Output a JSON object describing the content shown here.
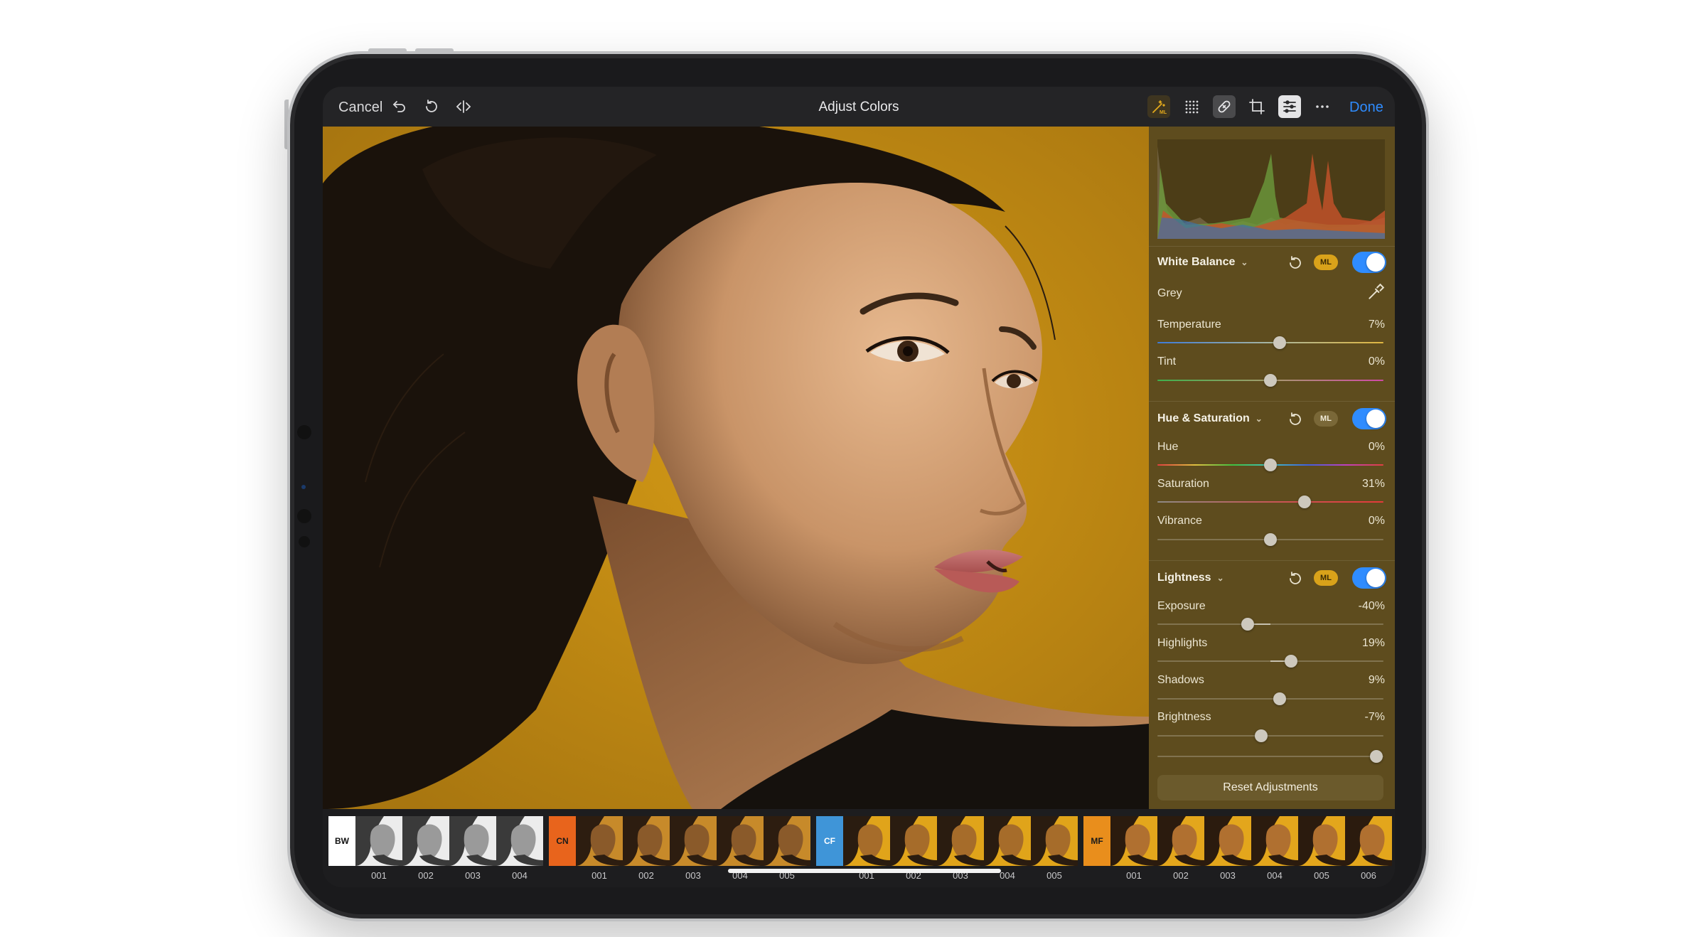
{
  "toolbar": {
    "cancel_label": "Cancel",
    "title": "Adjust Colors",
    "done_label": "Done",
    "icons": [
      "undo-icon",
      "revert-icon",
      "compare-icon",
      "ml-enhance-icon",
      "grid-icon",
      "repair-brush-icon",
      "crop-icon",
      "adjustments-icon",
      "more-icon"
    ]
  },
  "panel": {
    "white_balance": {
      "title": "White Balance",
      "ml": "ML",
      "enabled": true,
      "grey_label": "Grey",
      "temperature": {
        "label": "Temperature",
        "value": "7%",
        "position": 0.54
      },
      "tint": {
        "label": "Tint",
        "value": "0%",
        "position": 0.5
      }
    },
    "hue_saturation": {
      "title": "Hue & Saturation",
      "ml": "ML",
      "enabled": true,
      "hue": {
        "label": "Hue",
        "value": "0%",
        "position": 0.5
      },
      "saturation": {
        "label": "Saturation",
        "value": "31%",
        "position": 0.65
      },
      "vibrance": {
        "label": "Vibrance",
        "value": "0%",
        "position": 0.5
      }
    },
    "lightness": {
      "title": "Lightness",
      "ml": "ML",
      "enabled": true,
      "exposure": {
        "label": "Exposure",
        "value": "-40%",
        "position": 0.4
      },
      "highlights": {
        "label": "Highlights",
        "value": "19%",
        "position": 0.59
      },
      "shadows": {
        "label": "Shadows",
        "value": "9%",
        "position": 0.54
      },
      "brightness": {
        "label": "Brightness",
        "value": "-7%",
        "position": 0.46
      }
    },
    "reset_label": "Reset Adjustments"
  },
  "filmstrip": {
    "groups": [
      {
        "tag": "BW",
        "tag_color": "#ffffff",
        "tag_text_color": "#111111",
        "style": "bw",
        "items": [
          "001",
          "002",
          "003",
          "004"
        ]
      },
      {
        "tag": "CN",
        "tag_color": "#e8641c",
        "tag_text_color": "#1a1a1a",
        "style": "cn",
        "items": [
          "001",
          "002",
          "003",
          "004",
          "005"
        ]
      },
      {
        "tag": "CF",
        "tag_color": "#3f95d8",
        "tag_text_color": "#ffffff",
        "style": "cf",
        "items": [
          "001",
          "002",
          "003",
          "004",
          "005"
        ]
      },
      {
        "tag": "MF",
        "tag_color": "#e98e1c",
        "tag_text_color": "#1a1a1a",
        "style": "mf",
        "items": [
          "001",
          "002",
          "003",
          "004",
          "005",
          "006"
        ]
      }
    ]
  },
  "colors": {
    "accent": "#2f8cff",
    "photo_background": "#c58f12",
    "panel_background": "#5e4c1e"
  }
}
